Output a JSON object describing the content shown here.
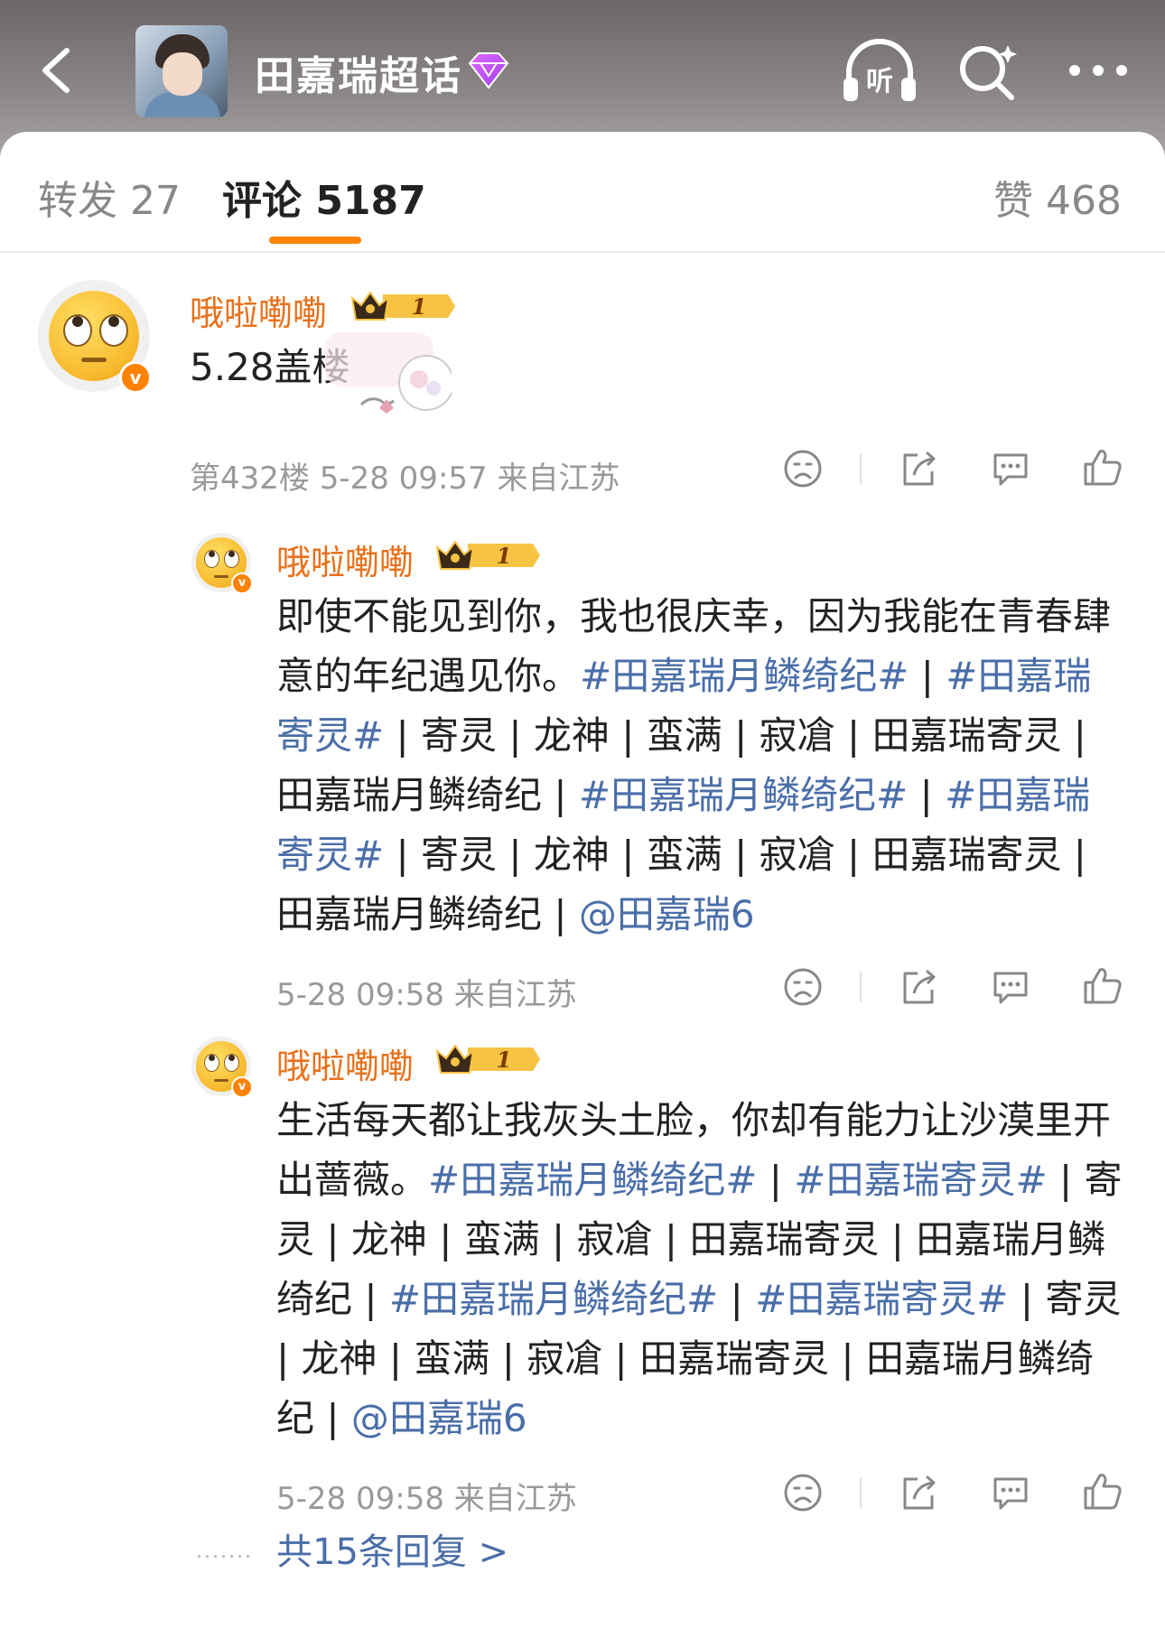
{
  "header": {
    "title": "田嘉瑞超话",
    "listen_label": "听"
  },
  "tabs": {
    "forward": "转发 27",
    "comments": "评论 5187",
    "likes": "赞 468"
  },
  "main_comment": {
    "username": "哦啦嘞嘞",
    "level": "1",
    "verified": "v",
    "text": "5.28盖楼",
    "meta": "第432楼 5-28 09:57 来自江苏"
  },
  "replies": [
    {
      "username": "哦啦嘞嘞",
      "level": "1",
      "verified": "v",
      "segments": [
        {
          "t": "即使不能见到你，我也很庆幸，因为我能在青春肆意的年纪遇见你。",
          "k": "text"
        },
        {
          "t": "#田嘉瑞月鳞绮纪#",
          "k": "topic"
        },
        {
          "t": " | ",
          "k": "sep"
        },
        {
          "t": "#田嘉瑞寄灵#",
          "k": "topic"
        },
        {
          "t": " | 寄灵 | 龙神 | 蛮满 | 寂凔 | 田嘉瑞寄灵 | 田嘉瑞月鳞绮纪 | ",
          "k": "text"
        },
        {
          "t": "#田嘉瑞月鳞绮纪#",
          "k": "topic"
        },
        {
          "t": " | ",
          "k": "sep"
        },
        {
          "t": "#田嘉瑞寄灵#",
          "k": "topic"
        },
        {
          "t": " | 寄灵 | 龙神 | 蛮满 | 寂凔 | 田嘉瑞寄灵 | 田嘉瑞月鳞绮纪 | ",
          "k": "text"
        },
        {
          "t": "@田嘉瑞6",
          "k": "topic"
        }
      ],
      "meta": "5-28 09:58 来自江苏"
    },
    {
      "username": "哦啦嘞嘞",
      "level": "1",
      "verified": "v",
      "segments": [
        {
          "t": "生活每天都让我灰头土脸，你却有能力让沙漠里开出蔷薇。",
          "k": "text"
        },
        {
          "t": "#田嘉瑞月鳞绮纪#",
          "k": "topic"
        },
        {
          "t": " | ",
          "k": "sep"
        },
        {
          "t": "#田嘉瑞寄灵#",
          "k": "topic"
        },
        {
          "t": " | 寄灵 | 龙神 | 蛮满 | 寂凔 | 田嘉瑞寄灵 | 田嘉瑞月鳞绮纪 | ",
          "k": "text"
        },
        {
          "t": "#田嘉瑞月鳞绮纪#",
          "k": "topic"
        },
        {
          "t": " | ",
          "k": "sep"
        },
        {
          "t": "#田嘉瑞寄灵#",
          "k": "topic"
        },
        {
          "t": " | 寄灵 | 龙神 | 蛮满 | 寂凔 | 田嘉瑞寄灵 | 田嘉瑞月鳞绮纪 | ",
          "k": "text"
        },
        {
          "t": "@田嘉瑞6",
          "k": "topic"
        }
      ],
      "meta": "5-28 09:58 来自江苏"
    }
  ],
  "more_replies": "共15条回复 >",
  "colors": {
    "accent": "#ff8200",
    "username": "#e8711b",
    "topic": "#4a6ea8"
  },
  "icons": [
    "back-arrow-icon",
    "diamond-icon",
    "listen-icon",
    "search-icon",
    "more-icon",
    "dislike-icon",
    "share-icon",
    "comment-icon",
    "like-icon"
  ]
}
